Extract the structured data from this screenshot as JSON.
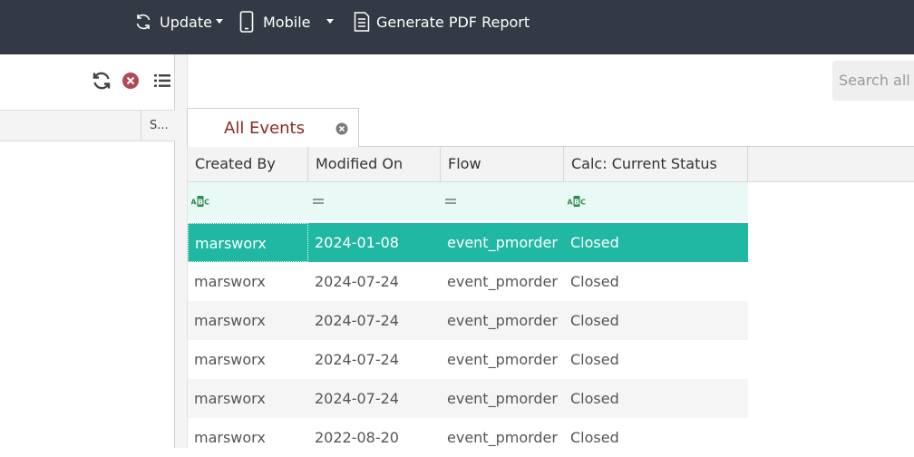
{
  "toolbar": {
    "update_label": "Update",
    "mobile_label": "Mobile",
    "pdf_label": "Generate PDF Report"
  },
  "left_panel": {
    "column_s_label": "S..."
  },
  "search": {
    "placeholder": "Search all A"
  },
  "tabs": [
    {
      "label": "All Events",
      "active": true
    }
  ],
  "grid": {
    "columns": [
      "Created By",
      "Modified On",
      "Flow",
      "Calc: Current Status"
    ],
    "filter_icons": [
      "text-filter-icon",
      "equals-filter-icon",
      "equals-filter-icon",
      "text-filter-icon"
    ],
    "rows": [
      {
        "created_by": "marsworx",
        "modified_on": "2024-01-08",
        "flow": "event_pmorder",
        "status": "Closed",
        "selected": true
      },
      {
        "created_by": "marsworx",
        "modified_on": "2024-07-24",
        "flow": "event_pmorder",
        "status": "Closed"
      },
      {
        "created_by": "marsworx",
        "modified_on": "2024-07-24",
        "flow": "event_pmorder",
        "status": "Closed"
      },
      {
        "created_by": "marsworx",
        "modified_on": "2024-07-24",
        "flow": "event_pmorder",
        "status": "Closed"
      },
      {
        "created_by": "marsworx",
        "modified_on": "2024-07-24",
        "flow": "event_pmorder",
        "status": "Closed"
      },
      {
        "created_by": "marsworx",
        "modified_on": "2022-08-20",
        "flow": "event_pmorder",
        "status": "Closed"
      }
    ]
  },
  "colors": {
    "topbar": "#343a45",
    "selected_row": "#21b8a3",
    "filter_row": "#e9f9f5",
    "tab_text": "#8b2a22"
  }
}
